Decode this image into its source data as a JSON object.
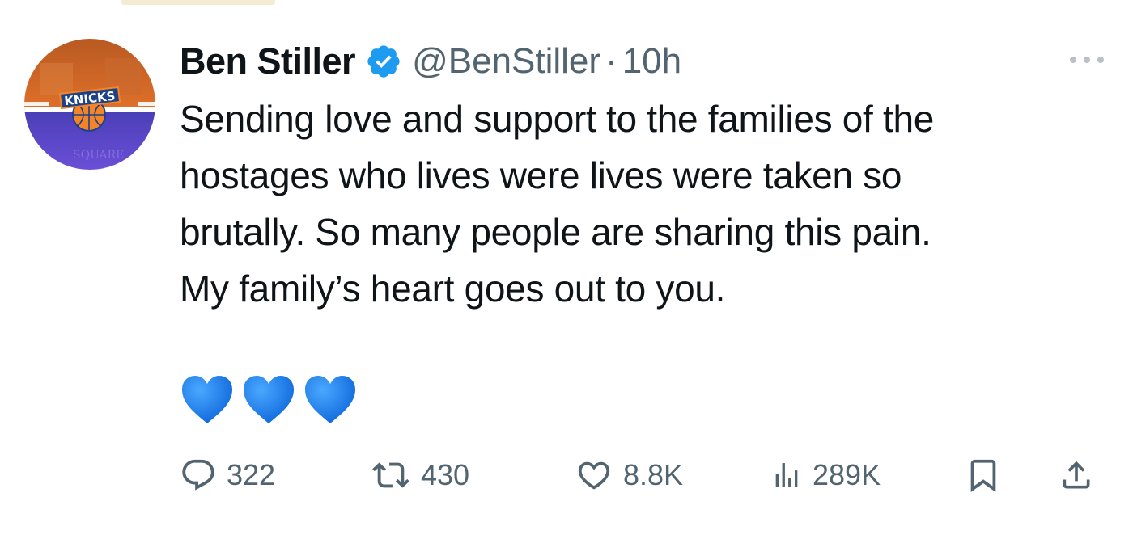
{
  "author": {
    "name": "Ben Stiller",
    "handle": "@BenStiller",
    "separator": "·",
    "time": "10h",
    "verified": true,
    "avatar_text": "KNICKS"
  },
  "tweet": {
    "lines": [
      "Sending love and support to the families of the",
      "hostages who lives were lives were taken so",
      "brutally. So many people are sharing this pain.",
      "My family’s heart goes out to you."
    ],
    "emoji": [
      "blue-heart",
      "blue-heart",
      "blue-heart"
    ]
  },
  "metrics": {
    "replies": "322",
    "retweets": "430",
    "likes": "8.8K",
    "views": "289K"
  },
  "colors": {
    "verified_blue": "#1d9bf0",
    "heart_blue": "#1e7ff0",
    "muted": "#536471",
    "text": "#0f1419",
    "knicks_orange": "#f58426",
    "knicks_blue": "#5a45c9"
  }
}
